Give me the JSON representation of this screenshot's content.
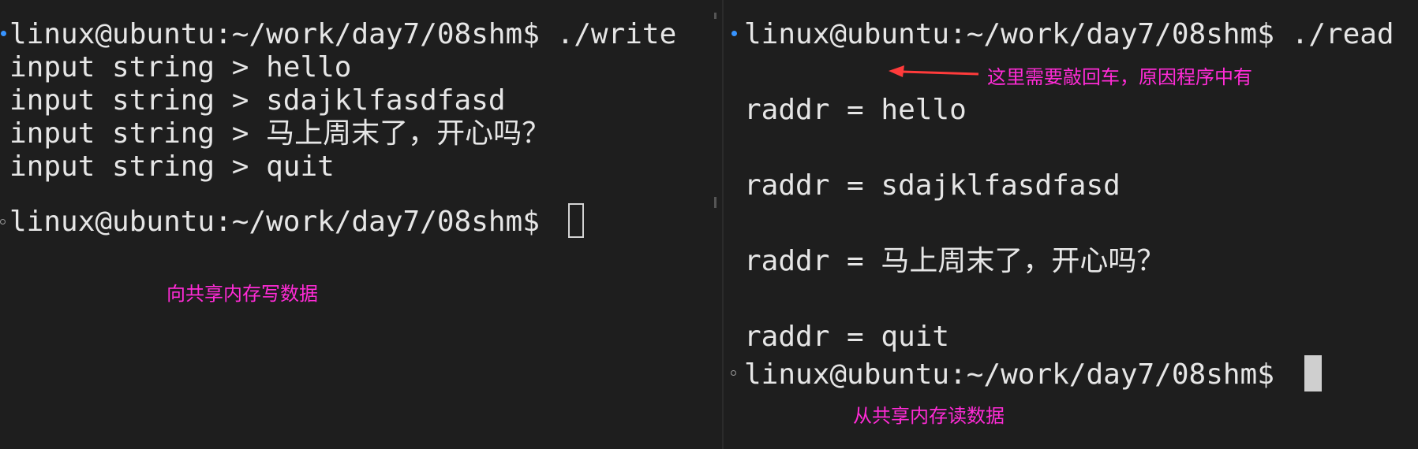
{
  "left_pane": {
    "lines": [
      "linux@ubuntu:~/work/day7/08shm$ ./write",
      "input string > hello",
      "input string > sdajklfasdfasd",
      "input string > 马上周末了，开心吗？",
      "input string > quit",
      "linux@ubuntu:~/work/day7/08shm$ "
    ],
    "annotation": "向共享内存写数据"
  },
  "right_pane": {
    "lines": [
      "linux@ubuntu:~/work/day7/08shm$ ./read",
      "",
      "raddr = hello",
      "",
      "raddr = sdajklfasdfasd",
      "",
      "raddr = 马上周末了，开心吗？",
      "",
      "raddr = quit",
      "linux@ubuntu:~/work/day7/08shm$ "
    ],
    "annotation_top": "这里需要敲回车，原因程序中有",
    "annotation_bottom": "从共享内存读数据"
  },
  "colors": {
    "background": "#1e1e1e",
    "text": "#e6e6e6",
    "annotation": "#ff2bd6",
    "arrow": "#ff3b3b",
    "status_dot": "#3794ff"
  }
}
